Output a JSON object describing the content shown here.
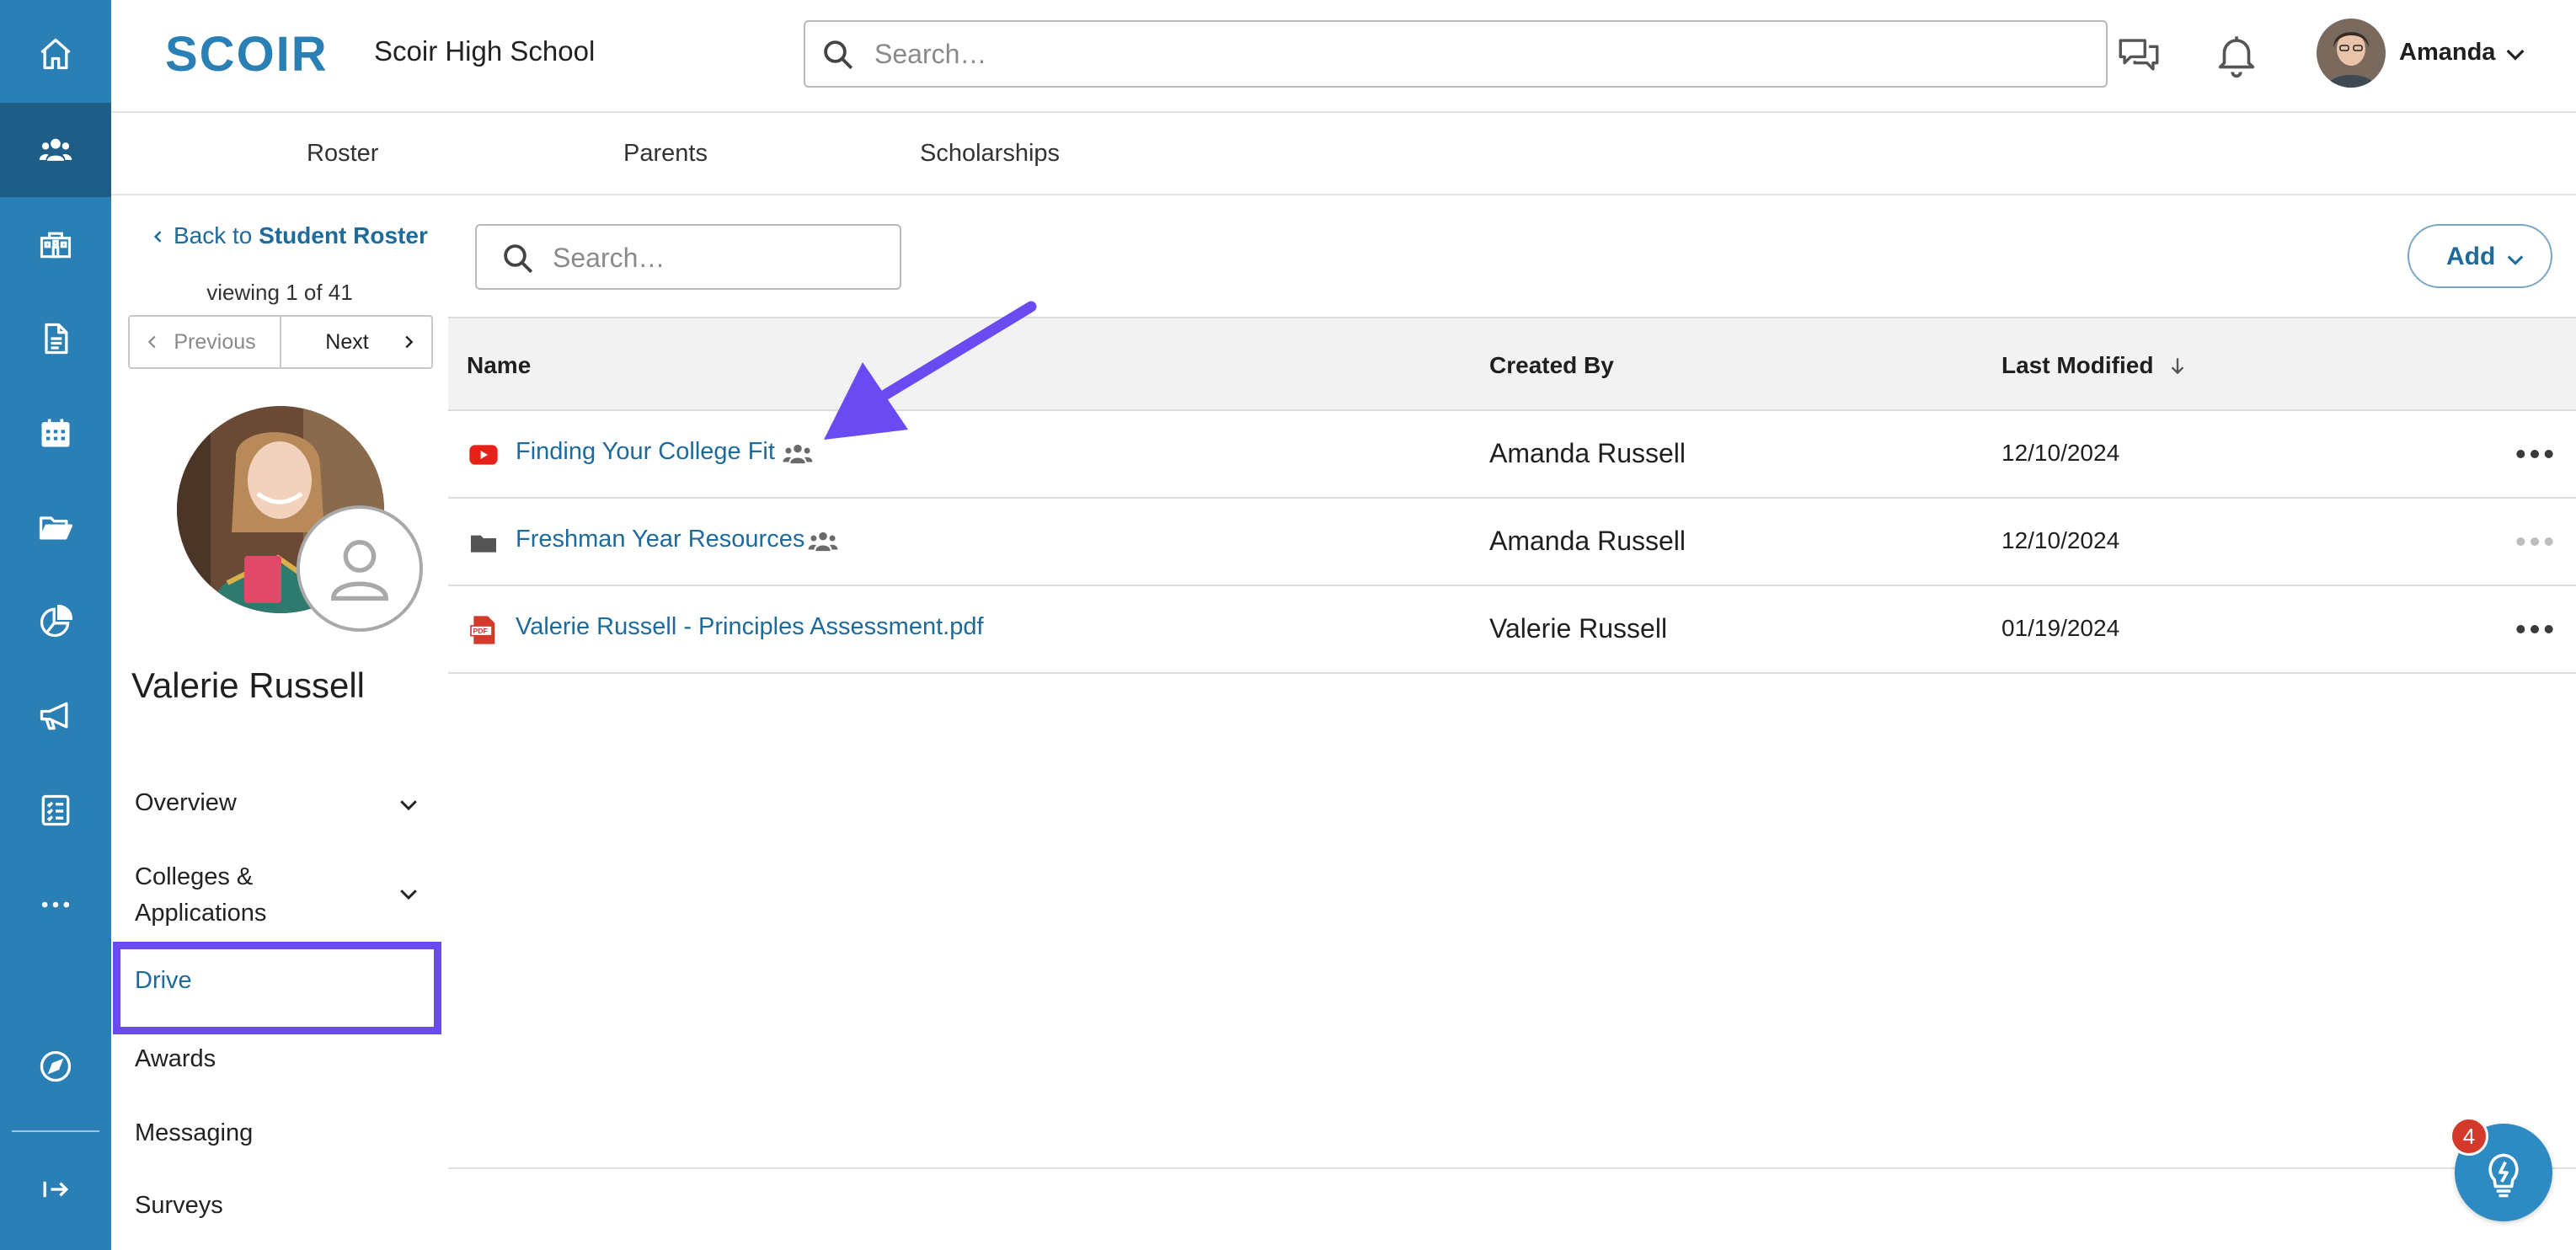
{
  "app": {
    "brand": "SCOIR",
    "school_name": "Scoir High School"
  },
  "topbar": {
    "search_placeholder": "Search…",
    "user_name": "Amanda",
    "icons": [
      "messages-icon",
      "bell-icon",
      "chevron-down-icon"
    ]
  },
  "rail": {
    "items": [
      "home-icon",
      "students-icon",
      "school-icon",
      "document-icon",
      "calendar-icon",
      "folder-icon",
      "analytics-icon",
      "megaphone-icon",
      "checklist-icon",
      "more-icon",
      "compass-icon",
      "collapse-icon"
    ],
    "active": "students-icon"
  },
  "subnav": {
    "tabs": [
      {
        "label": "Roster"
      },
      {
        "label": "Parents"
      },
      {
        "label": "Scholarships"
      }
    ]
  },
  "student": {
    "back_prefix": "Back to",
    "back_target": "Student Roster",
    "viewing": "viewing 1 of 41",
    "prev_label": "Previous",
    "next_label": "Next",
    "name": "Valerie Russell",
    "menu": [
      {
        "label": "Overview"
      },
      {
        "label": "Colleges &"
      },
      {
        "label": "Applications"
      },
      {
        "label": "Drive"
      },
      {
        "label": "Awards"
      },
      {
        "label": "Messaging"
      },
      {
        "label": "Surveys"
      }
    ]
  },
  "drive": {
    "search_placeholder": "Search…",
    "add_label": "Add",
    "columns": {
      "name": "Name",
      "created_by": "Created By",
      "last_modified": "Last Modified"
    },
    "rows": [
      {
        "name": "Finding Your College Fit",
        "type": "youtube-icon",
        "shared": true,
        "created_by": "Amanda Russell",
        "modified": "12/10/2024"
      },
      {
        "name": "Freshman Year Resources",
        "type": "folder-icon",
        "shared": true,
        "created_by": "Amanda Russell",
        "modified": "12/10/2024"
      },
      {
        "name": "Valerie Russell - Principles Assessment.pdf",
        "type": "pdf-icon",
        "shared": false,
        "created_by": "Valerie Russell",
        "modified": "01/19/2024"
      }
    ]
  },
  "help": {
    "badge_count": "4"
  },
  "colors": {
    "rail": "#2a7fb5",
    "rail_active": "#1d5d86",
    "link": "#1e6a9a",
    "highlight": "#6a4bf2"
  }
}
